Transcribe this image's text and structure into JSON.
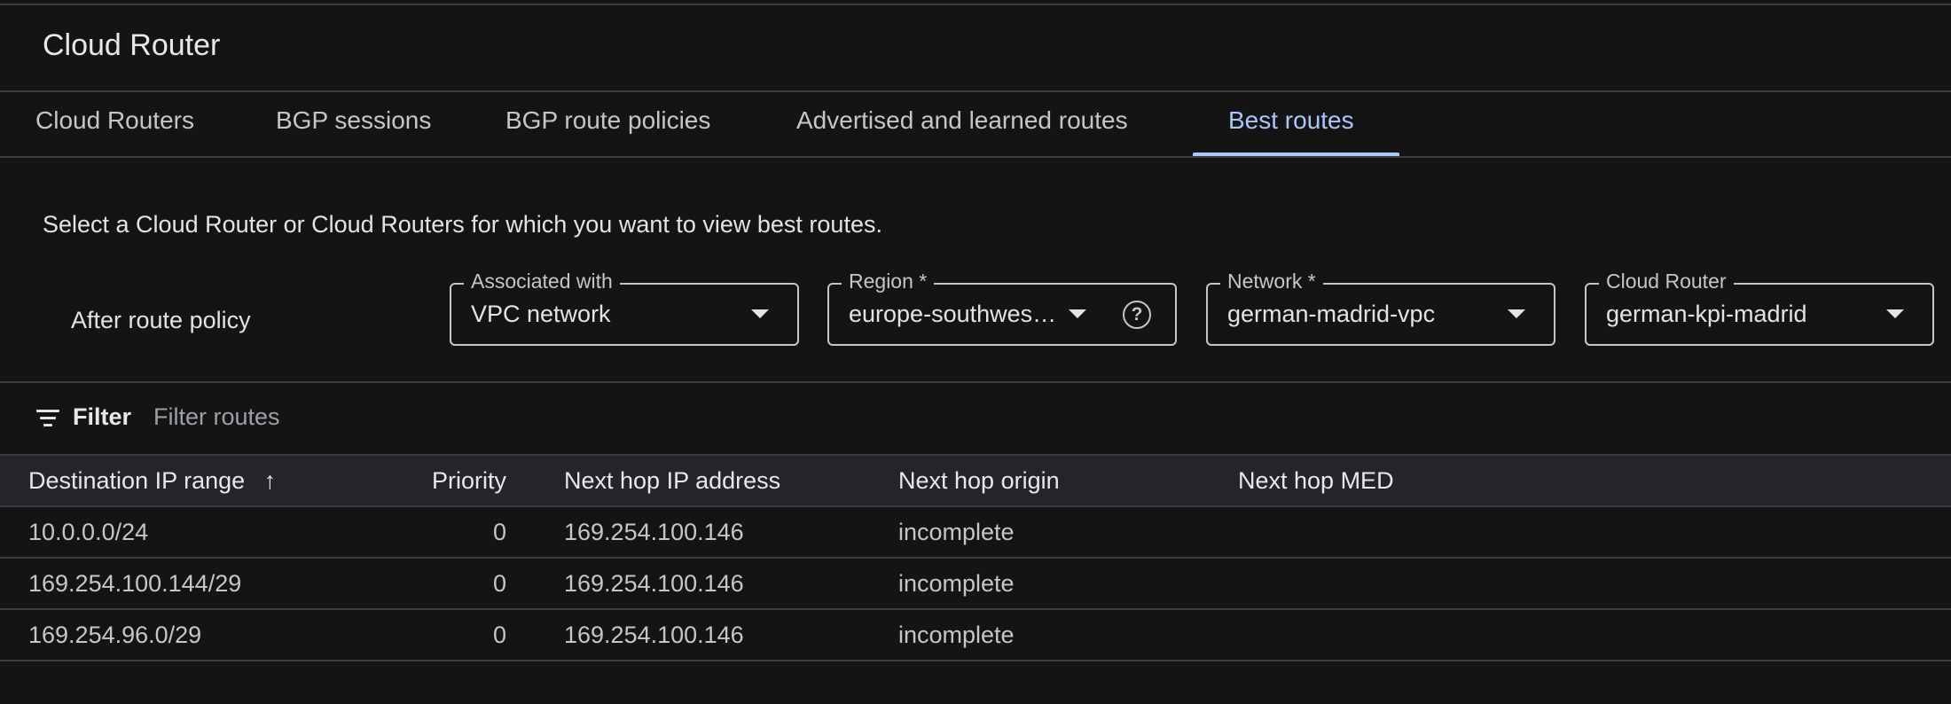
{
  "header": {
    "title": "Cloud Router"
  },
  "tabs": [
    {
      "label": "Cloud Routers",
      "active": false
    },
    {
      "label": "BGP sessions",
      "active": false
    },
    {
      "label": "BGP route policies",
      "active": false
    },
    {
      "label": "Advertised and learned routes",
      "active": false
    },
    {
      "label": "Best routes",
      "active": true
    }
  ],
  "description": "Select a Cloud Router or Cloud Routers for which you want to view best routes.",
  "route_policy_label": "After route policy",
  "fields": [
    {
      "label": "Associated with",
      "value": "VPC network"
    },
    {
      "label": "Region *",
      "value": "europe-southwes…",
      "help": "?"
    },
    {
      "label": "Network *",
      "value": "german-madrid-vpc"
    },
    {
      "label": "Cloud Router",
      "value": "german-kpi-madrid"
    }
  ],
  "filter": {
    "label": "Filter",
    "placeholder": "Filter routes"
  },
  "table": {
    "columns": [
      "Destination IP range",
      "Priority",
      "Next hop IP address",
      "Next hop origin",
      "Next hop MED"
    ],
    "sort": "ascending",
    "rows": [
      [
        "10.0.0.0/24",
        "0",
        "169.254.100.146",
        "incomplete",
        ""
      ],
      [
        "169.254.100.144/29",
        "0",
        "169.254.100.146",
        "incomplete",
        ""
      ],
      [
        "169.254.96.0/29",
        "0",
        "169.254.100.146",
        "incomplete",
        ""
      ]
    ]
  },
  "colors": {
    "accent": "#a8c7fa",
    "background": "#141414"
  }
}
